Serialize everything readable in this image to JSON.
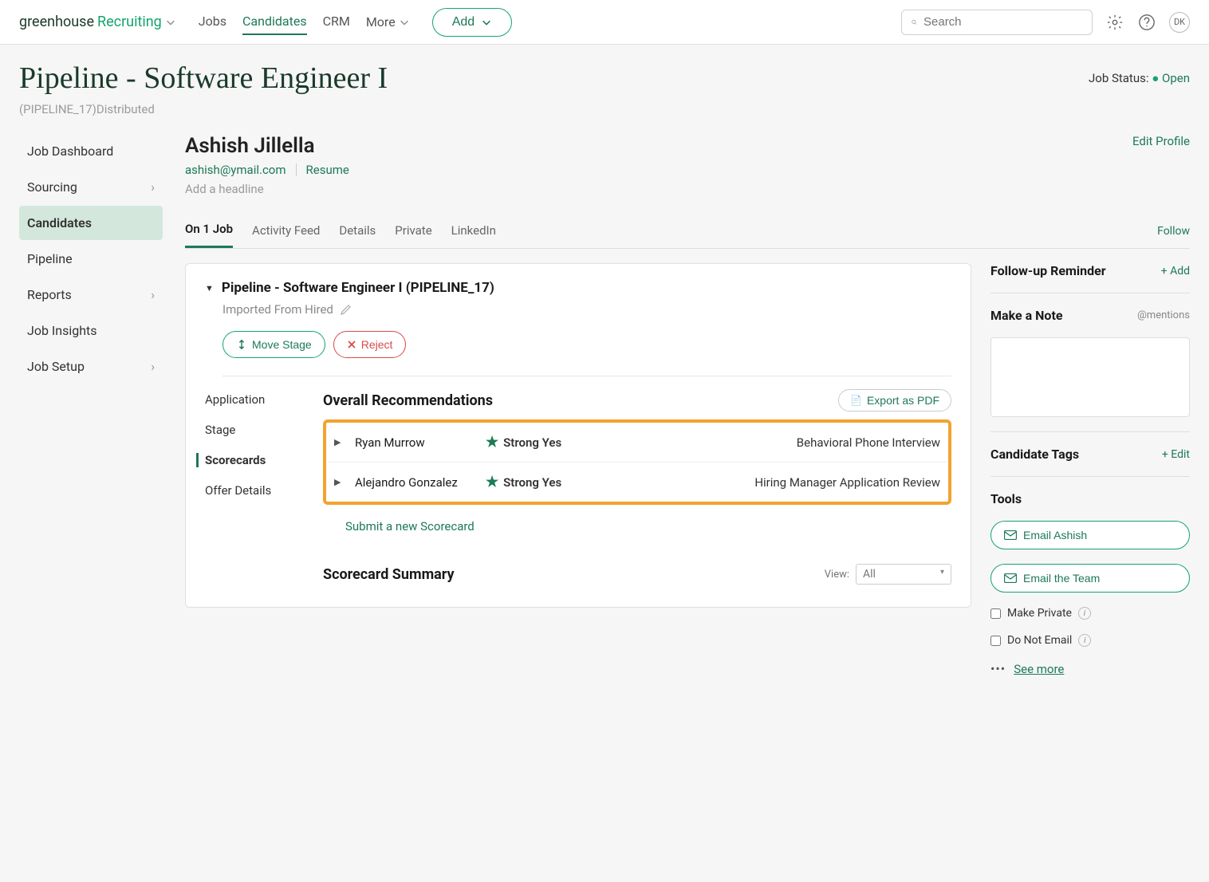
{
  "topbar": {
    "logo_dark": "greenhouse",
    "logo_green": "Recruiting",
    "nav": {
      "jobs": "Jobs",
      "candidates": "Candidates",
      "crm": "CRM",
      "more": "More"
    },
    "add": "Add",
    "search_placeholder": "Search",
    "avatar": "DK"
  },
  "header": {
    "title": "Pipeline - Software Engineer I",
    "status_label": "Job Status:",
    "status_value": "Open",
    "sub": "(PIPELINE_17)Distributed"
  },
  "sidebar": {
    "dashboard": "Job Dashboard",
    "sourcing": "Sourcing",
    "candidates": "Candidates",
    "pipeline": "Pipeline",
    "reports": "Reports",
    "insights": "Job Insights",
    "setup": "Job Setup"
  },
  "candidate": {
    "name": "Ashish Jillella",
    "email": "ashish@ymail.com",
    "resume": "Resume",
    "headline": "Add a headline",
    "edit": "Edit Profile"
  },
  "tabs": {
    "on_job": "On 1 Job",
    "activity": "Activity Feed",
    "details": "Details",
    "private": "Private",
    "linkedin": "LinkedIn",
    "follow": "Follow"
  },
  "card": {
    "title": "Pipeline - Software Engineer I (PIPELINE_17)",
    "source": "Imported From Hired",
    "move": "Move Stage",
    "reject": "Reject"
  },
  "sc_nav": {
    "application": "Application",
    "stage": "Stage",
    "scorecards": "Scorecards",
    "offer": "Offer Details"
  },
  "scorecards": {
    "title": "Overall Recommendations",
    "export": "Export as PDF",
    "rows": [
      {
        "name": "Ryan Murrow",
        "rating": "Strong Yes",
        "stage": "Behavioral Phone Interview"
      },
      {
        "name": "Alejandro Gonzalez",
        "rating": "Strong Yes",
        "stage": "Hiring Manager Application Review"
      }
    ],
    "submit": "Submit a new Scorecard",
    "summary": "Scorecard Summary",
    "view_label": "View:",
    "view_value": "All"
  },
  "right": {
    "followup": "Follow-up Reminder",
    "add": "+ Add",
    "note": "Make a Note",
    "mentions": "@mentions",
    "tags": "Candidate Tags",
    "edit": "+ Edit",
    "tools": "Tools",
    "email_cand": "Email Ashish",
    "email_team": "Email the Team",
    "private": "Make Private",
    "no_email": "Do Not Email",
    "see_more": "See more"
  }
}
